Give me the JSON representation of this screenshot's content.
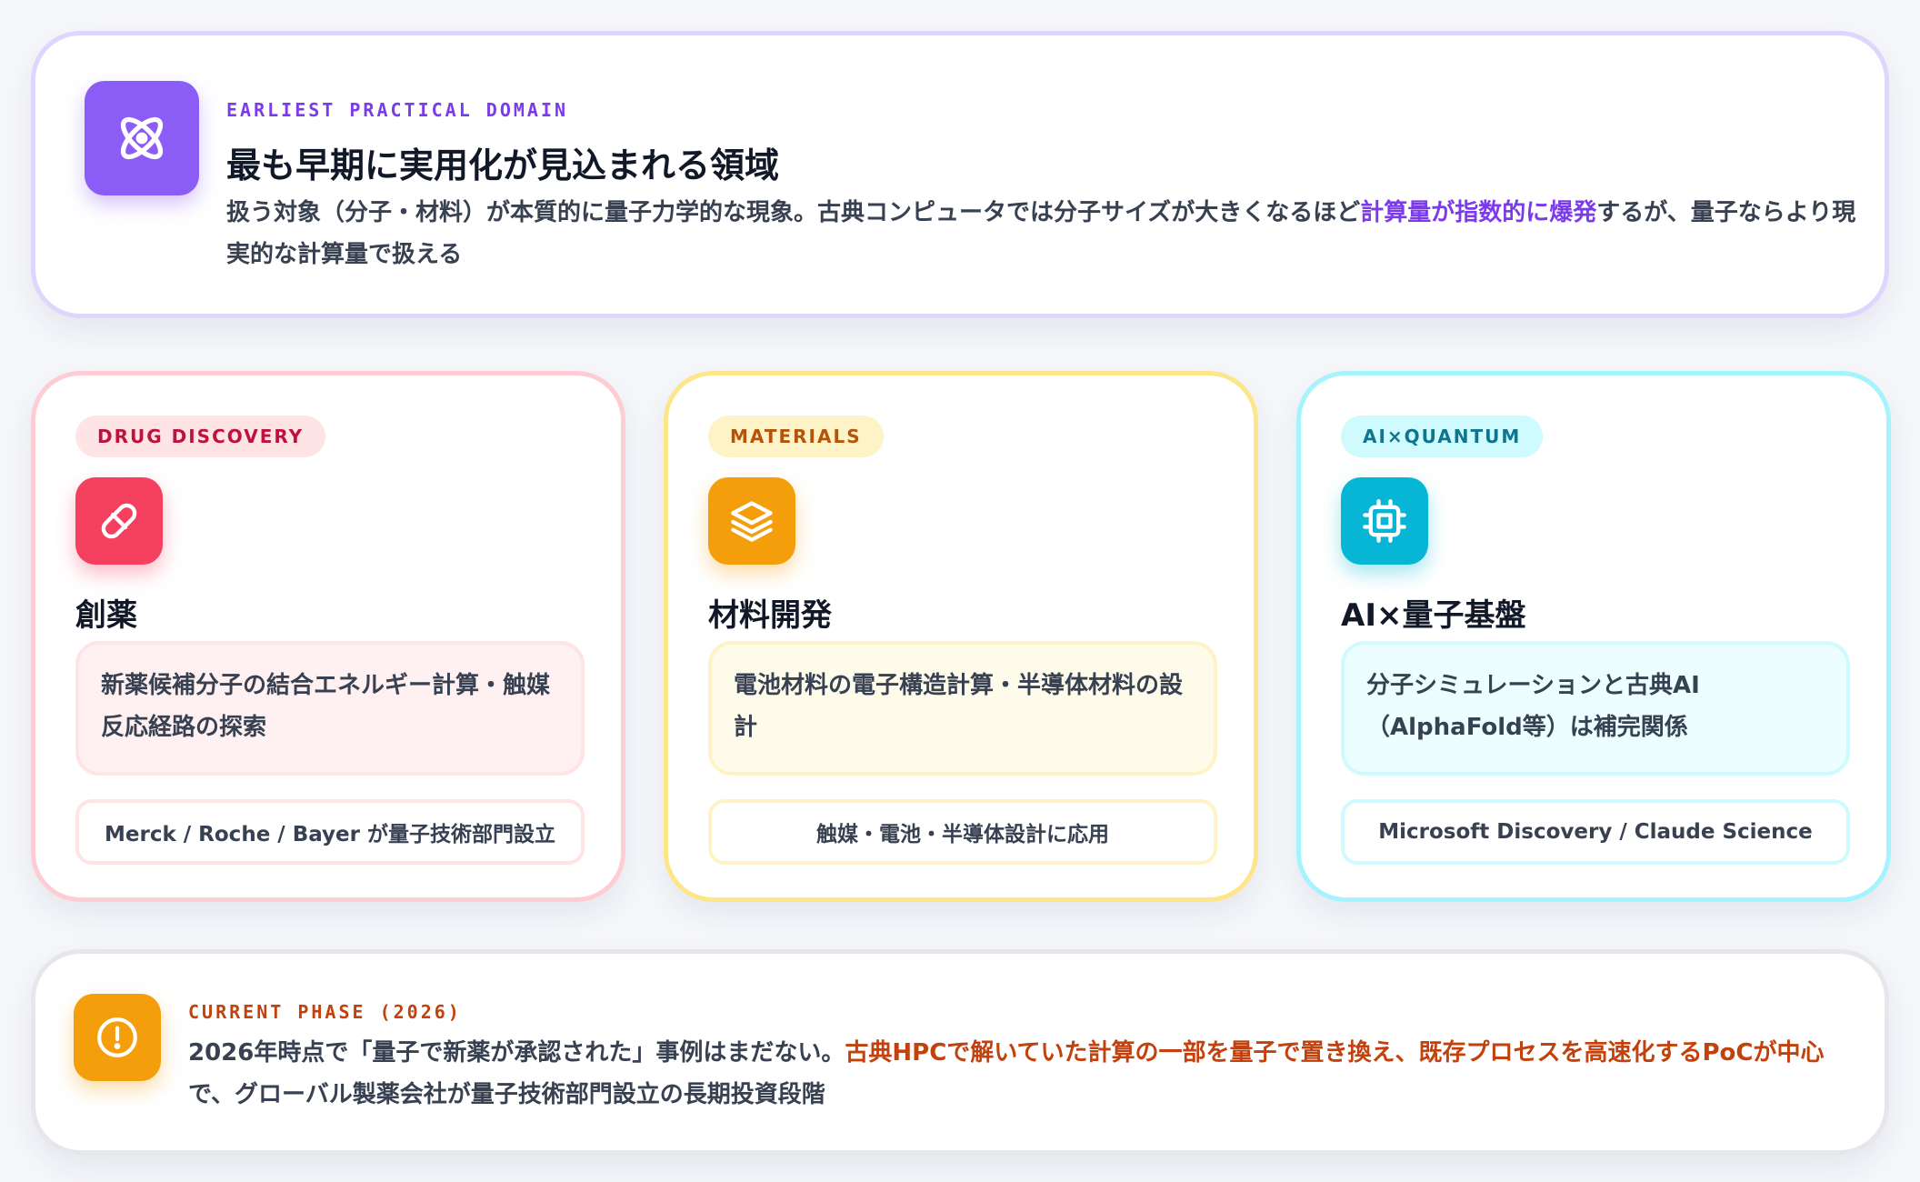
{
  "colors": {
    "purple": "#8b5cf6",
    "rose": "#f43f5e",
    "amber": "#f59e0b",
    "cyan": "#06b6d4"
  },
  "top": {
    "icon": "atom-icon",
    "eyebrow": "EARLIEST PRACTICAL DOMAIN",
    "title": "最も早期に実用化が見込まれる領域",
    "desc_before": "扱う対象（分子・材料）が本質的に量子力学的な現象。古典コンピュータでは分子サイズが大きくなるほど",
    "desc_highlight": "計算量が指数的に爆発",
    "desc_after": "するが、量子ならより現実的な計算量で扱える"
  },
  "cards": [
    {
      "tag": "DRUG DISCOVERY",
      "icon": "pill-icon",
      "title": "創薬",
      "detail": "新薬候補分子の結合エネルギー計算・触媒反応経路の探索",
      "footer": "Merck / Roche / Bayer が量子技術部門設立"
    },
    {
      "tag": "MATERIALS",
      "icon": "layers-icon",
      "title": "材料開発",
      "detail": "電池材料の電子構造計算・半導体材料の設計",
      "footer": "触媒・電池・半導体設計に応用"
    },
    {
      "tag": "AI×QUANTUM",
      "icon": "cpu-chip-icon",
      "title": "AI×量子基盤",
      "detail": "分子シミュレーションと古典AI（AlphaFold等）は補完関係",
      "footer": "Microsoft Discovery / Claude Science"
    }
  ],
  "bottom": {
    "icon": "alert-circle-icon",
    "eyebrow": "CURRENT PHASE (2026)",
    "desc_before": "2026年時点で「量子で新薬が承認された」事例はまだない。",
    "desc_highlight": "古典HPCで解いていた計算の一部を量子で置き換え、既存プロセスを高速化するPoCが中心",
    "desc_after": "で、グローバル製薬会社が量子技術部門設立の長期投資段階"
  }
}
